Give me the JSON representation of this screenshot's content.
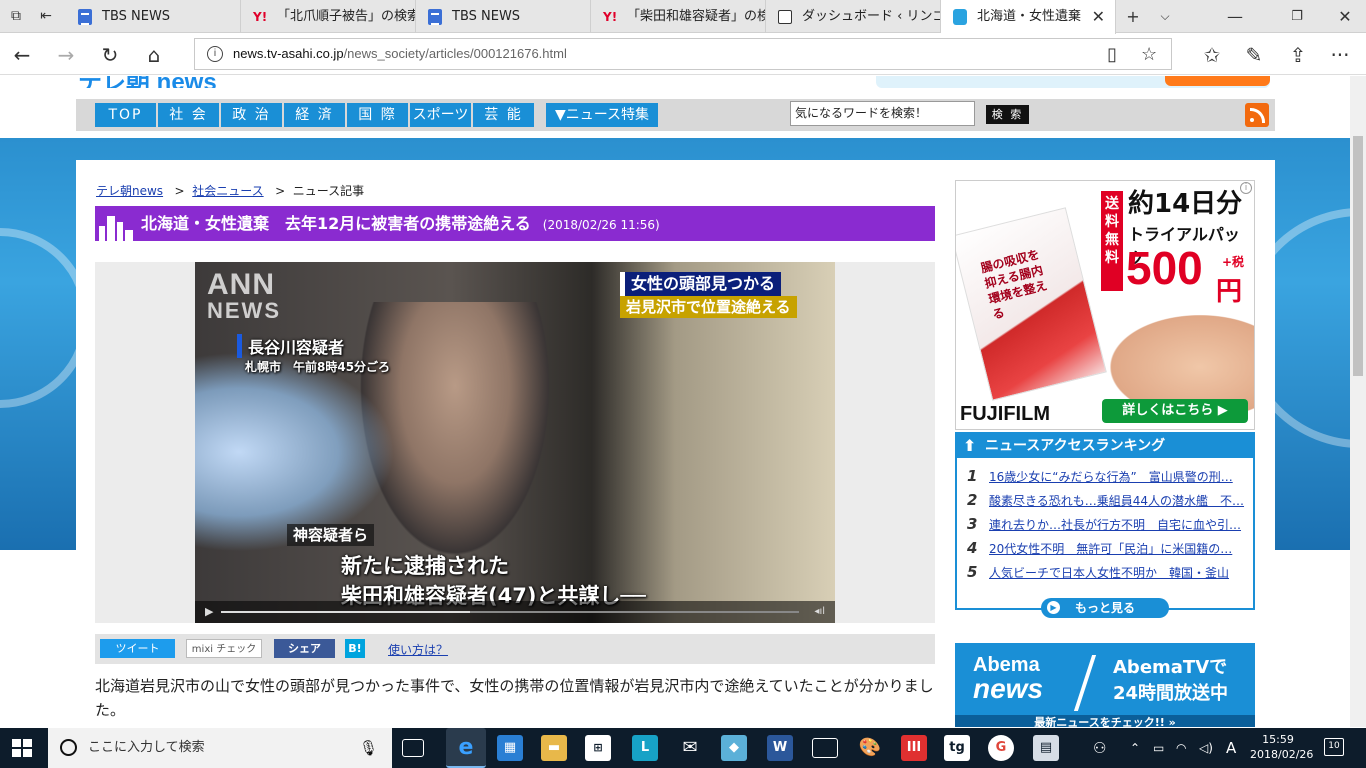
{
  "browser": {
    "tabs": [
      {
        "title": "TBS NEWS",
        "icon": "document-icon"
      },
      {
        "title": "「北爪順子被告」の検索結",
        "icon": "yahoo-icon"
      },
      {
        "title": "TBS NEWS",
        "icon": "document-icon"
      },
      {
        "title": "「柴田和雄容疑者」の検索",
        "icon": "yahoo-icon"
      },
      {
        "title": "ダッシュボード ‹ リンゴの部",
        "icon": "dashboard-icon"
      },
      {
        "title": "北海道・女性遺棄",
        "icon": "tv-asahi-icon",
        "active": true
      }
    ],
    "url_domain": "news.tv-asahi.co.jp",
    "url_path": "/news_society/articles/000121676.html"
  },
  "site": {
    "nav": [
      "TOP",
      "社 会",
      "政 治",
      "経 済",
      "国 際",
      "スポーツ",
      "芸 能"
    ],
    "special": "▼ニュース特集",
    "search_placeholder": "気になるワードを検索！",
    "search_button": "検 索"
  },
  "article": {
    "breadcrumb": [
      "テレ朝news",
      "社会ニュース",
      "ニュース記事"
    ],
    "title": "北海道・女性遺棄　去年12月に被害者の携帯途絶える",
    "date": "(2018/02/26 11:56)",
    "body": "北海道岩見沢市の山で女性の頭部が見つかった事件で、女性の携帯の位置情報が岩見沢市内で途絶えていたことが分かりました。"
  },
  "video": {
    "watermark1": "ANN",
    "watermark2": "NEWS",
    "caption_top1": "女性の頭部見つかる",
    "caption_top2": "岩見沢市で位置途絶える",
    "caption_name": "長谷川容疑者",
    "caption_place": "札幌市　午前8時45分ごろ",
    "caption_sub_label": "神容疑者ら",
    "subtitle1": "新たに逮捕された",
    "subtitle2": "柴田和雄容疑者(47)と共謀し──",
    "buffered_fraction": 0.43
  },
  "share": {
    "tweet": "ツイート",
    "mixi": "mixi チェック",
    "facebook": "シェア",
    "hatena": "B!",
    "howto": "使い方は？"
  },
  "ad1": {
    "free_shipping": "送料無料",
    "headline": "約14日分",
    "sub": "トライアルパック",
    "price": "500",
    "yen_tax": "+税",
    "yen": "円",
    "pack_text": "腸の吸収を抑える腸内環境を整える",
    "brand": "FUJIFILM",
    "cta": "詳しくはこちら ▶"
  },
  "ranking": {
    "title": "ニュースアクセスランキング",
    "items": [
      {
        "n": "1",
        "t": "16歳少女に“みだらな行為”　富山県警の刑…"
      },
      {
        "n": "2",
        "t": "酸素尽きる恐れも…乗組員44人の潜水艦　不…"
      },
      {
        "n": "3",
        "t": "連れ去りか…社長が行方不明　自宅に血や引…"
      },
      {
        "n": "4",
        "t": "20代女性不明　無許可「民泊」に米国籍の…"
      },
      {
        "n": "5",
        "t": "人気ビーチで日本人女性不明か　韓国・釜山"
      }
    ],
    "more": "もっと見る"
  },
  "ad2": {
    "logo1": "Abema",
    "logo2": "news",
    "text1": "AbemaTVで",
    "text2": "24時間放送中",
    "footer": "最新ニュースをチェック!! »"
  },
  "taskbar": {
    "search_placeholder": "ここに入力して検索",
    "time": "15:59",
    "date": "2018/02/26",
    "ime": "A",
    "notifications": "10"
  }
}
